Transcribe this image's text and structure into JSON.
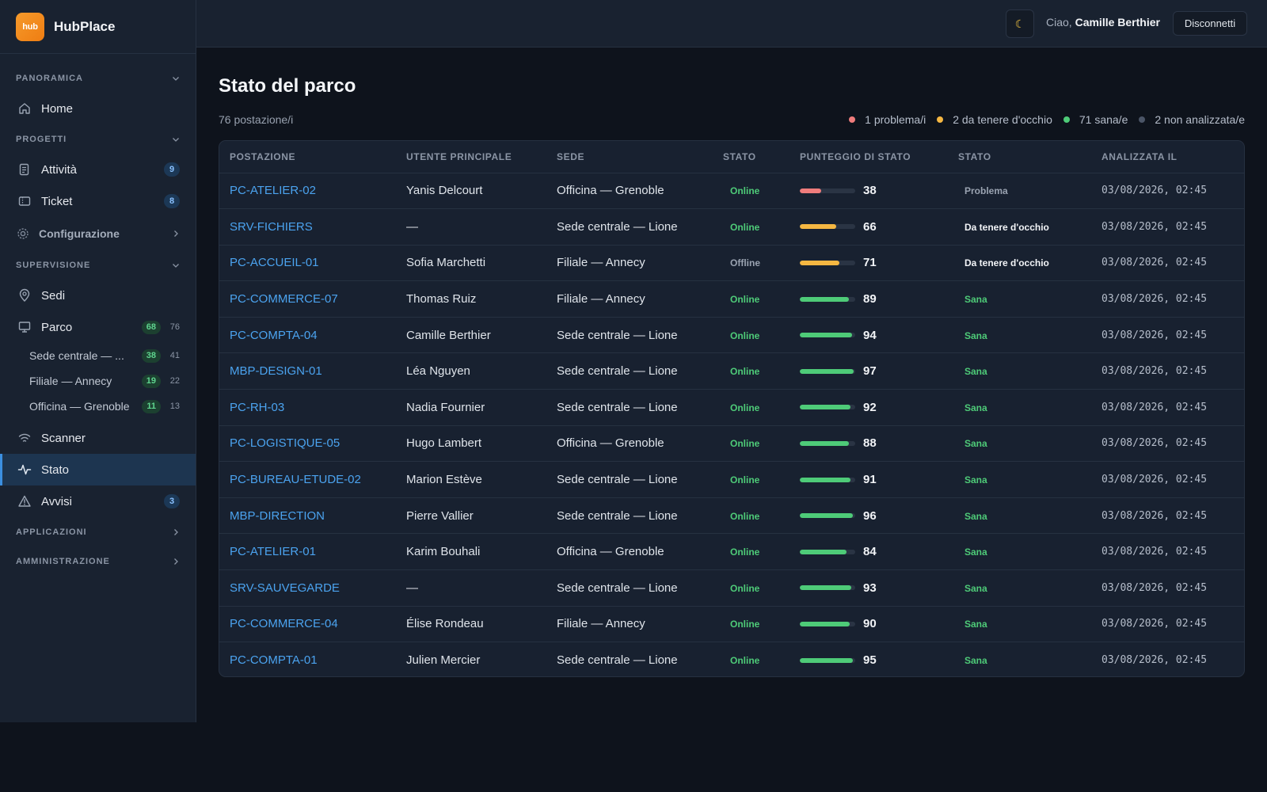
{
  "brand": {
    "logo_text": "hub",
    "name": "HubPlace"
  },
  "header": {
    "theme_icon": "☾",
    "greeting_prefix": "Ciao,",
    "user_name": "Camille Berthier",
    "logout_label": "Disconnetti"
  },
  "sidebar": {
    "sections": {
      "panoramica": "PANORAMICA",
      "progetti": "PROGETTI",
      "supervisione": "SUPERVISIONE",
      "applicazioni": "APPLICAZIONI",
      "amministrazione": "AMMINISTRAZIONE"
    },
    "home": "Home",
    "attivita": {
      "label": "Attività",
      "badge": "9"
    },
    "ticket": {
      "label": "Ticket",
      "badge": "8"
    },
    "configurazione": "Configurazione",
    "sedi": "Sedi",
    "parco": {
      "label": "Parco",
      "online": "68",
      "total": "76"
    },
    "sites": [
      {
        "label": "Sede centrale — ...",
        "online": "38",
        "total": "41"
      },
      {
        "label": "Filiale — Annecy",
        "online": "19",
        "total": "22"
      },
      {
        "label": "Officina — Grenoble",
        "online": "11",
        "total": "13"
      }
    ],
    "scanner": "Scanner",
    "stato": "Stato",
    "avvisi": {
      "label": "Avvisi",
      "badge": "3"
    }
  },
  "main": {
    "title": "Stato del parco",
    "subtitle": "76 postazione/i",
    "legend": [
      {
        "label": "1 problema/i",
        "color": "#ef7c7c"
      },
      {
        "label": "2 da tenere d'occhio",
        "color": "#f5b742"
      },
      {
        "label": "71 sana/e",
        "color": "#4ecb78"
      },
      {
        "label": "2 non analizzata/e",
        "color": "#4b5567"
      }
    ],
    "columns": [
      "POSTAZIONE",
      "UTENTE PRINCIPALE",
      "SEDE",
      "STATO",
      "PUNTEGGIO DI STATO",
      "STATO",
      "ANALIZZATA IL"
    ],
    "rows": [
      {
        "host": "PC-ATELIER-02",
        "user": "Yanis Delcourt",
        "site": "Officina — Grenoble",
        "status": "Online",
        "score": 38,
        "health": "Problema",
        "date": "03/08/2026, 02:45"
      },
      {
        "host": "SRV-FICHIERS",
        "user": "—",
        "site": "Sede centrale — Lione",
        "status": "Online",
        "score": 66,
        "health": "Da tenere d'occhio",
        "date": "03/08/2026, 02:45"
      },
      {
        "host": "PC-ACCUEIL-01",
        "user": "Sofia Marchetti",
        "site": "Filiale — Annecy",
        "status": "Offline",
        "score": 71,
        "health": "Da tenere d'occhio",
        "date": "03/08/2026, 02:45"
      },
      {
        "host": "PC-COMMERCE-07",
        "user": "Thomas Ruiz",
        "site": "Filiale — Annecy",
        "status": "Online",
        "score": 89,
        "health": "Sana",
        "date": "03/08/2026, 02:45"
      },
      {
        "host": "PC-COMPTA-04",
        "user": "Camille Berthier",
        "site": "Sede centrale — Lione",
        "status": "Online",
        "score": 94,
        "health": "Sana",
        "date": "03/08/2026, 02:45"
      },
      {
        "host": "MBP-DESIGN-01",
        "user": "Léa Nguyen",
        "site": "Sede centrale — Lione",
        "status": "Online",
        "score": 97,
        "health": "Sana",
        "date": "03/08/2026, 02:45"
      },
      {
        "host": "PC-RH-03",
        "user": "Nadia Fournier",
        "site": "Sede centrale — Lione",
        "status": "Online",
        "score": 92,
        "health": "Sana",
        "date": "03/08/2026, 02:45"
      },
      {
        "host": "PC-LOGISTIQUE-05",
        "user": "Hugo Lambert",
        "site": "Officina — Grenoble",
        "status": "Online",
        "score": 88,
        "health": "Sana",
        "date": "03/08/2026, 02:45"
      },
      {
        "host": "PC-BUREAU-ETUDE-02",
        "user": "Marion Estève",
        "site": "Sede centrale — Lione",
        "status": "Online",
        "score": 91,
        "health": "Sana",
        "date": "03/08/2026, 02:45"
      },
      {
        "host": "MBP-DIRECTION",
        "user": "Pierre Vallier",
        "site": "Sede centrale — Lione",
        "status": "Online",
        "score": 96,
        "health": "Sana",
        "date": "03/08/2026, 02:45"
      },
      {
        "host": "PC-ATELIER-01",
        "user": "Karim Bouhali",
        "site": "Officina — Grenoble",
        "status": "Online",
        "score": 84,
        "health": "Sana",
        "date": "03/08/2026, 02:45"
      },
      {
        "host": "SRV-SAUVEGARDE",
        "user": "—",
        "site": "Sede centrale — Lione",
        "status": "Online",
        "score": 93,
        "health": "Sana",
        "date": "03/08/2026, 02:45"
      },
      {
        "host": "PC-COMMERCE-04",
        "user": "Élise Rondeau",
        "site": "Filiale — Annecy",
        "status": "Online",
        "score": 90,
        "health": "Sana",
        "date": "03/08/2026, 02:45"
      },
      {
        "host": "PC-COMPTA-01",
        "user": "Julien Mercier",
        "site": "Sede centrale — Lione",
        "status": "Online",
        "score": 95,
        "health": "Sana",
        "date": "03/08/2026, 02:45"
      }
    ]
  },
  "colors": {
    "problem": "#ef7c7c",
    "watch": "#f5b742",
    "healthy": "#4ecb78",
    "link": "#4ba3ef",
    "accent": "#3b8fe0"
  }
}
